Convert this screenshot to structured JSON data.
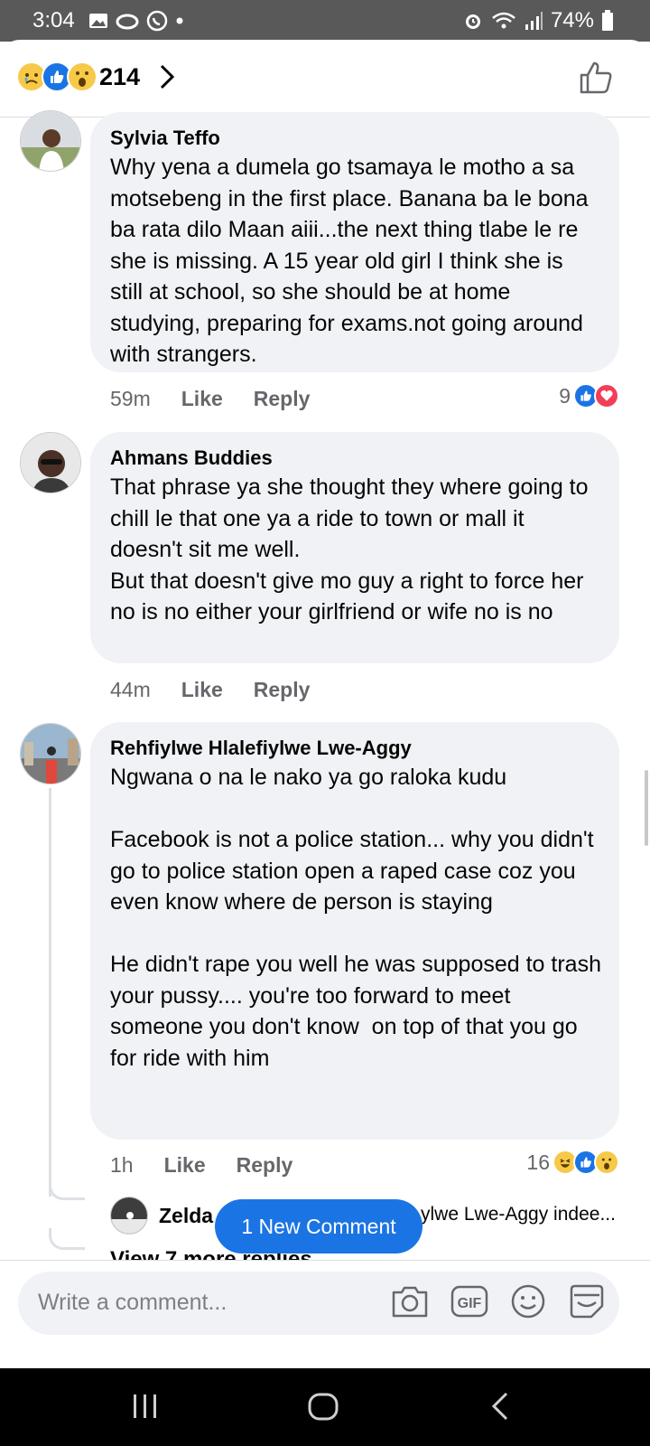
{
  "status_bar": {
    "time": "3:04",
    "battery": "74%",
    "left_icons": [
      "gallery-icon",
      "cloud-icon",
      "whatsapp-icon",
      "dot-icon"
    ],
    "right_icons": [
      "alarm-icon",
      "wifi-icon",
      "signal-icon",
      "battery-icon"
    ]
  },
  "header": {
    "reaction_count": "214",
    "reactions": [
      "sad-reaction-icon",
      "like-reaction-icon",
      "wow-reaction-icon"
    ],
    "chevron_icon": "chevron-right-icon",
    "like_icon": "thumbs-up-outline-icon"
  },
  "comments": [
    {
      "name": "Sylvia Teffo",
      "text": "Why yena a dumela go tsamaya le motho a sa motsebeng in the first place. Banana ba le bona ba rata dilo Maan aiii...the next thing tlabe le re she is missing. A 15 year old girl I think she is still at school, so she should be at home studying, preparing for exams.not going around with strangers.",
      "time": "59m",
      "like_label": "Like",
      "reply_label": "Reply",
      "reaction_count": "9",
      "reaction_icons": [
        "like-reaction-icon",
        "love-reaction-icon"
      ]
    },
    {
      "name": "Ahmans Buddies",
      "text": "That phrase ya she thought they where going to chill le that one ya a ride to town or mall it doesn't sit me well.\nBut that doesn't give mo guy a right to force her no is no either your girlfriend or wife no is no",
      "time": "44m",
      "like_label": "Like",
      "reply_label": "Reply"
    },
    {
      "name": "Rehfiylwe Hlalefiylwe Lwe-Aggy",
      "text": "Ngwana o na le nako ya go raloka kudu\n\nFacebook is not a police station... why you didn't go to police station open a raped case coz you even know where de person is staying\n\nHe didn't rape you well he was supposed to trash your pussy.... you're too forward to meet someone you don't know  on top of that you go for ride with him",
      "time": "1h",
      "like_label": "Like",
      "reply_label": "Reply",
      "reaction_count": "16",
      "reaction_icons": [
        "haha-reaction-icon",
        "like-reaction-icon",
        "wow-reaction-icon"
      ]
    }
  ],
  "reply_preview": {
    "name": "Zelda",
    "text": "ylwe Lwe-Aggy indee..."
  },
  "view_more": "View 7 more replies",
  "new_comment_button": "1 New Comment",
  "composer": {
    "placeholder": "Write a comment...",
    "icons": [
      "camera-icon",
      "gif-icon",
      "emoji-icon",
      "sticker-icon"
    ]
  },
  "colors": {
    "accent": "#1b74e4",
    "bubble": "#f0f2f5",
    "meta_text": "#65676b",
    "status_bar": "#595959"
  }
}
